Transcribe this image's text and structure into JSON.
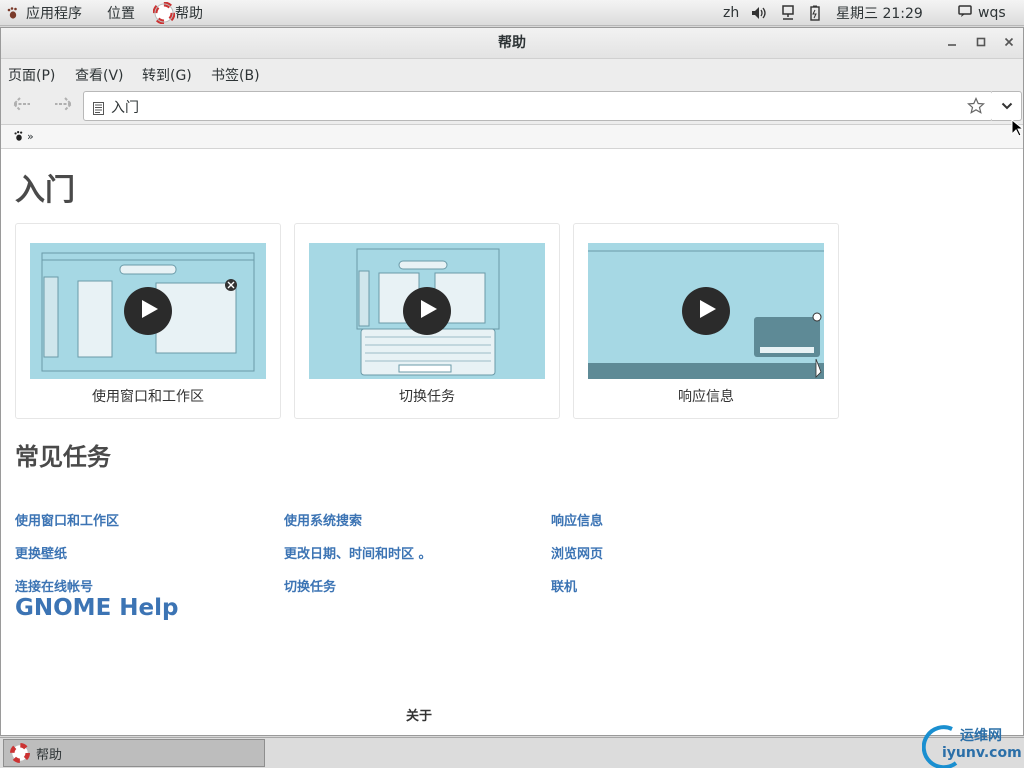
{
  "topbar": {
    "apps": "应用程序",
    "places": "位置",
    "active_app": "帮助",
    "lang": "zh",
    "clock": "星期三 21:29",
    "user": "wqs"
  },
  "window": {
    "title": "帮助",
    "menus": [
      "页面(P)",
      "查看(V)",
      "转到(G)",
      "书签(B)"
    ],
    "location": "入门",
    "crumb_sep": "»"
  },
  "content": {
    "heading": "入门",
    "cards": [
      {
        "label": "使用窗口和工作区"
      },
      {
        "label": "切换任务"
      },
      {
        "label": "响应信息"
      }
    ],
    "common_heading": "常见任务",
    "tasks": [
      [
        "使用窗口和工作区",
        "使用系统搜索",
        "响应信息"
      ],
      [
        "更换壁纸",
        "更改日期、时间和时区 。",
        "浏览网页"
      ],
      [
        "连接在线帐号",
        "切换任务",
        "联机"
      ]
    ],
    "gnome_help": "GNOME Help",
    "about": "关于"
  },
  "taskbar": {
    "item": "帮助"
  },
  "watermark": {
    "line1": "运维网",
    "line2": "iyunv.com"
  },
  "colors": {
    "link": "#3c74b4",
    "thumb_bg": "#a6d8e4",
    "heading": "#4a4a4a"
  }
}
